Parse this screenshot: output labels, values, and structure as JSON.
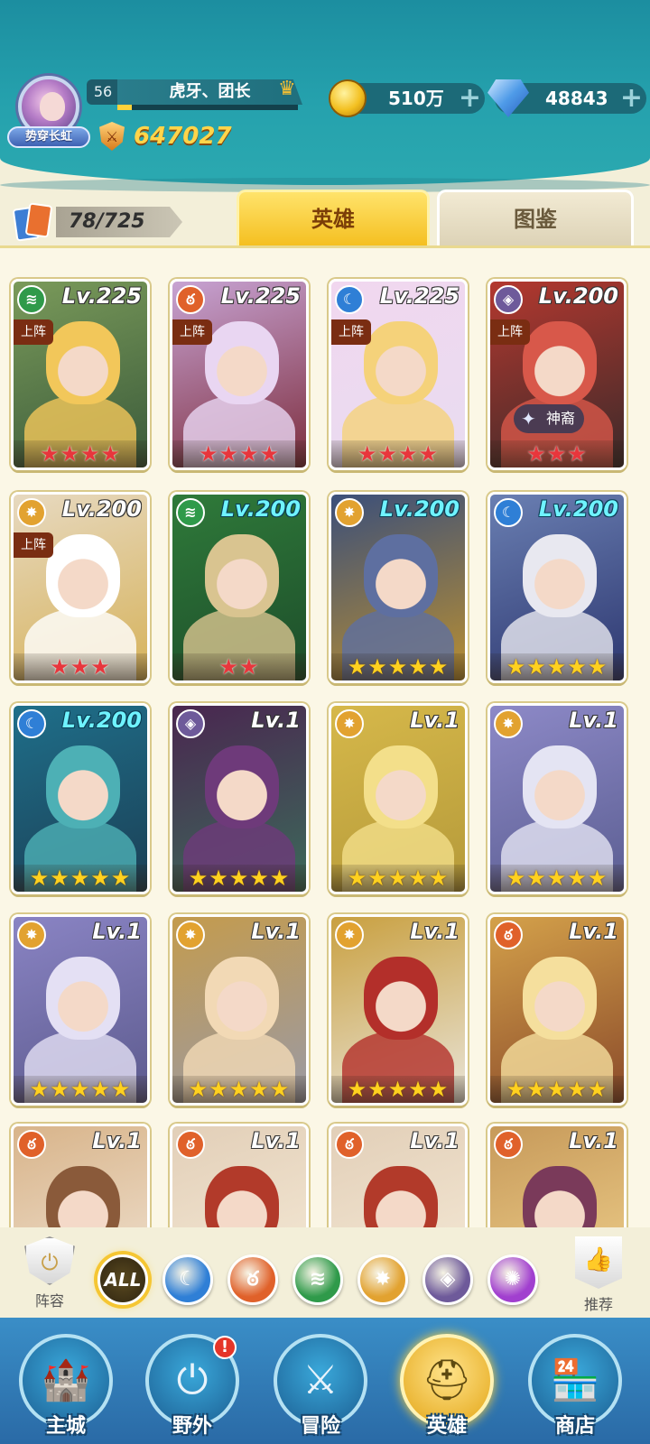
{
  "player": {
    "title": "势穿长虹",
    "level": "56",
    "name": "虎牙、团长",
    "power": "647027"
  },
  "resources": {
    "gold": "510万",
    "gems": "48843",
    "plus": "+"
  },
  "collection": {
    "count": "78/725"
  },
  "tabs": {
    "heroes": "英雄",
    "codex": "图鉴"
  },
  "colors": {
    "wind": "#2f9a4a",
    "fire": "#e0612a",
    "water": "#2f7fd6",
    "light": "#e2a230",
    "dark": "#6e5a9a",
    "purple": "#a13fcf",
    "deploy_tag": "#7a2d12",
    "accent": "#f4be1e"
  },
  "heroes": [
    {
      "level": "Lv.225",
      "element": "wind-icon",
      "deploy": "上阵",
      "stars": "★★★★",
      "star_color": "red",
      "lv_color": "white"
    },
    {
      "level": "Lv.225",
      "element": "fire-icon",
      "deploy": "上阵",
      "stars": "★★★★",
      "star_color": "red",
      "lv_color": "white"
    },
    {
      "level": "Lv.225",
      "element": "water-icon",
      "deploy": "上阵",
      "stars": "★★★★",
      "star_color": "red",
      "lv_color": "white"
    },
    {
      "level": "Lv.200",
      "element": "dark-icon",
      "deploy": "上阵",
      "stars": "★★★",
      "star_color": "red",
      "lv_color": "white",
      "tag": "神裔"
    },
    {
      "level": "Lv.200",
      "element": "light-icon",
      "deploy": "上阵",
      "stars": "★★★",
      "star_color": "red",
      "lv_color": "white"
    },
    {
      "level": "Lv.200",
      "element": "wind-icon",
      "stars": "★★",
      "star_color": "red",
      "lv_color": "cyan"
    },
    {
      "level": "Lv.200",
      "element": "light-icon",
      "stars": "★★★★★",
      "star_color": "gold",
      "lv_color": "cyan"
    },
    {
      "level": "Lv.200",
      "element": "water-icon",
      "stars": "★★★★★",
      "star_color": "gold",
      "lv_color": "cyan"
    },
    {
      "level": "Lv.200",
      "element": "water-icon",
      "stars": "★★★★★",
      "star_color": "gold",
      "lv_color": "cyan"
    },
    {
      "level": "Lv.1",
      "element": "dark-icon",
      "stars": "★★★★★",
      "star_color": "gold",
      "lv_color": "white"
    },
    {
      "level": "Lv.1",
      "element": "light-icon",
      "stars": "★★★★★",
      "star_color": "gold",
      "lv_color": "white"
    },
    {
      "level": "Lv.1",
      "element": "light-icon",
      "stars": "★★★★★",
      "star_color": "gold",
      "lv_color": "white"
    },
    {
      "level": "Lv.1",
      "element": "light-icon",
      "stars": "★★★★★",
      "star_color": "gold",
      "lv_color": "white"
    },
    {
      "level": "Lv.1",
      "element": "light-icon",
      "stars": "★★★★★",
      "star_color": "gold",
      "lv_color": "white"
    },
    {
      "level": "Lv.1",
      "element": "light-icon",
      "stars": "★★★★★",
      "star_color": "gold",
      "lv_color": "white"
    },
    {
      "level": "Lv.1",
      "element": "fire-icon",
      "stars": "★★★★★",
      "star_color": "gold",
      "lv_color": "white"
    },
    {
      "level": "Lv.1",
      "element": "fire-icon",
      "stars": "",
      "star_color": "gold",
      "lv_color": "white"
    },
    {
      "level": "Lv.1",
      "element": "fire-icon",
      "stars": "",
      "star_color": "gold",
      "lv_color": "white"
    },
    {
      "level": "Lv.1",
      "element": "fire-icon",
      "stars": "",
      "star_color": "gold",
      "lv_color": "white"
    },
    {
      "level": "Lv.1",
      "element": "fire-icon",
      "stars": "",
      "star_color": "gold",
      "lv_color": "white"
    }
  ],
  "filters": {
    "lineup_label": "阵容",
    "all_label": "ALL",
    "recommend_label": "推荐",
    "elements": [
      "water-icon",
      "fire-icon",
      "wind-icon",
      "light-icon",
      "dark-icon",
      "purple-icon"
    ]
  },
  "nav": {
    "items": [
      {
        "label": "主城",
        "icon": "castle-icon"
      },
      {
        "label": "野外",
        "icon": "portal-icon",
        "alert": "!"
      },
      {
        "label": "冒险",
        "icon": "sword-icon"
      },
      {
        "label": "英雄",
        "icon": "helmet-icon",
        "active": true
      },
      {
        "label": "商店",
        "icon": "shop-icon"
      }
    ]
  }
}
